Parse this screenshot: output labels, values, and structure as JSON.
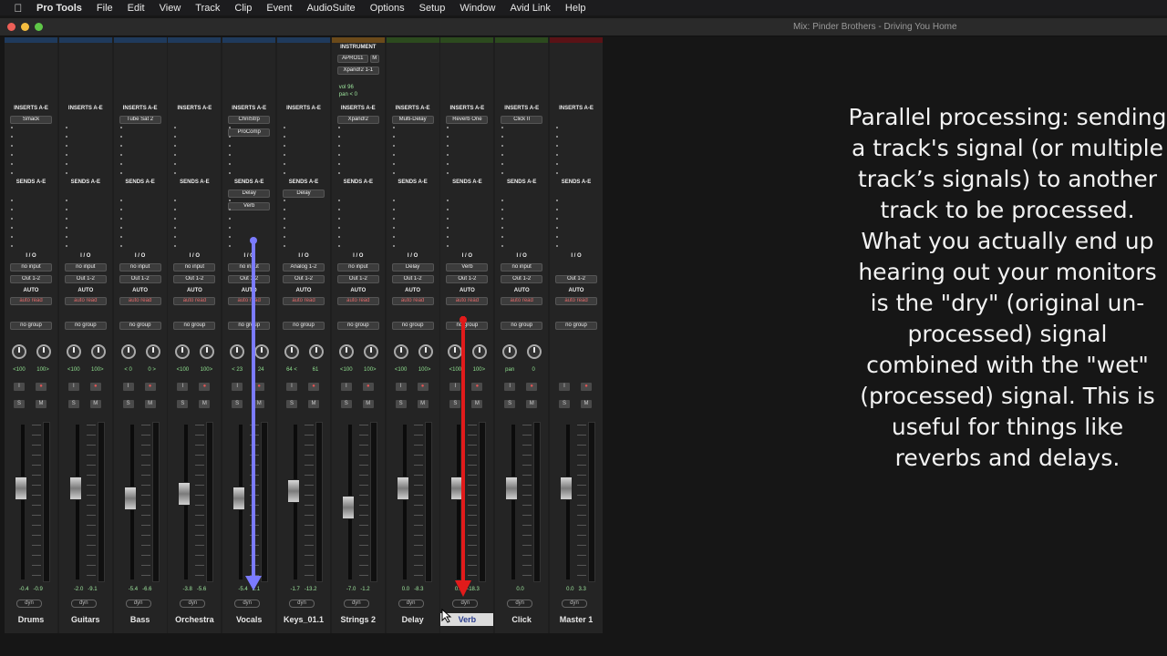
{
  "menubar": {
    "app": "Pro Tools",
    "items": [
      "File",
      "Edit",
      "View",
      "Track",
      "Clip",
      "Event",
      "AudioSuite",
      "Options",
      "Setup",
      "Window",
      "Avid Link",
      "Help"
    ]
  },
  "window": {
    "title": "Mix: Pinder Brothers - Driving You Home"
  },
  "labels": {
    "inserts": "INSERTS A-E",
    "sends": "SENDS A-E",
    "io": "I / O",
    "auto": "AUTO",
    "instrument": "INSTRUMENT"
  },
  "tracks": [
    {
      "name": "Drums",
      "color": "#1f3a5c",
      "insert": "Smack",
      "sends": [],
      "input": "no input",
      "output": "Out 1-2",
      "auto": "auto read",
      "group": "no group",
      "pan_l": "<100",
      "pan_r": "100>",
      "vol": "-0.4",
      "peak": "-0.9",
      "fader": 0.62,
      "selected": false
    },
    {
      "name": "Guitars",
      "color": "#1f3a5c",
      "insert": "",
      "sends": [],
      "input": "no input",
      "output": "Out 1-2",
      "auto": "auto read",
      "group": "no group",
      "pan_l": "<100",
      "pan_r": "100>",
      "vol": "-2.0",
      "peak": "-9.1",
      "fader": 0.62,
      "selected": false
    },
    {
      "name": "Bass",
      "color": "#1f3a5c",
      "insert": "Tube Sat 2",
      "sends": [],
      "input": "no input",
      "output": "Out 1-2",
      "auto": "auto read",
      "group": "no group",
      "pan_l": "< 0",
      "pan_r": "0 >",
      "vol": "-5.4",
      "peak": "-6.6",
      "fader": 0.55,
      "selected": false
    },
    {
      "name": "Orchestra",
      "color": "#1f3a5c",
      "insert": "",
      "sends": [],
      "input": "no input",
      "output": "Out 1-2",
      "auto": "auto read",
      "group": "no group",
      "pan_l": "<100",
      "pan_r": "100>",
      "vol": "-3.8",
      "peak": "-5.6",
      "fader": 0.58,
      "selected": false
    },
    {
      "name": "Vocals",
      "color": "#1f3a5c",
      "insert": "ChnlStrp",
      "insert2": "ProComp",
      "sends": [
        "Delay",
        "Verb"
      ],
      "input": "no input",
      "output": "Out 1-2",
      "auto": "auto read",
      "group": "no group",
      "pan_l": "< 23",
      "pan_r": "24",
      "vol": "-5.4",
      "peak": "2.1",
      "fader": 0.55,
      "selected": false
    },
    {
      "name": "Keys_01.1",
      "color": "#1f3a5c",
      "insert": "",
      "sends": [
        "Delay"
      ],
      "input": "Analog 1-2",
      "output": "Out 1-2",
      "auto": "auto read",
      "group": "no group",
      "pan_l": "64 <",
      "pan_r": "61",
      "vol": "-1.7",
      "peak": "-13.2",
      "fader": 0.6,
      "selected": false
    },
    {
      "name": "Strings 2",
      "color": "#6b4a1a",
      "insert": "Xpand!2",
      "sends": [],
      "input": "no input",
      "output": "Out 1-2",
      "auto": "auto read",
      "group": "no group",
      "pan_l": "<100",
      "pan_r": "100>",
      "vol": "-7.0",
      "peak": "-1.2",
      "fader": 0.48,
      "selected": false,
      "instrument": {
        "plugin": "APRO11",
        "mode": "M",
        "patch": "Xpand!2 1-1",
        "vol": "vol 96",
        "pan": "pan < 0"
      }
    },
    {
      "name": "Delay",
      "color": "#2c4a1e",
      "insert": "Multi-Delay",
      "sends": [],
      "input": "Delay",
      "output": "Out 1-2",
      "auto": "auto read",
      "group": "no group",
      "pan_l": "<100",
      "pan_r": "100>",
      "vol": "0.0",
      "peak": "-8.3",
      "fader": 0.62,
      "selected": false
    },
    {
      "name": "Verb",
      "color": "#2c4a1e",
      "insert": "Reverb One",
      "sends": [],
      "input": "Verb",
      "output": "Out 1-2",
      "auto": "auto read",
      "group": "no group",
      "pan_l": "<100",
      "pan_r": "100>",
      "vol": "0.0",
      "peak": "-18.3",
      "fader": 0.62,
      "selected": true
    },
    {
      "name": "Click",
      "color": "#2c4a1e",
      "insert": "Click II",
      "sends": [],
      "input": "no input",
      "output": "Out 1-2",
      "auto": "auto read",
      "group": "no group",
      "pan_l": "pan",
      "pan_r": "0",
      "vol": "0.0",
      "peak": "",
      "fader": 0.62,
      "selected": false
    },
    {
      "name": "Master 1",
      "color": "#5a1216",
      "insert": "",
      "sends": [],
      "input": "",
      "output": "Out 1-2",
      "auto": "auto read",
      "group": "no group",
      "pan_l": "",
      "pan_r": "",
      "vol": "0.0",
      "peak": "3.3",
      "fader": 0.62,
      "selected": false
    }
  ],
  "description": "Parallel processing: sending a track's signal (or multiple track’s signals) to another track to be processed. What you actually end up hearing out your monitors is the \"dry\" (original un-processed) signal combined with the \"wet\" (processed) signal. This is useful for things like reverbs and delays.",
  "colors": {
    "send_arrow": "#7b7bff",
    "return_arrow": "#e11b1b"
  }
}
